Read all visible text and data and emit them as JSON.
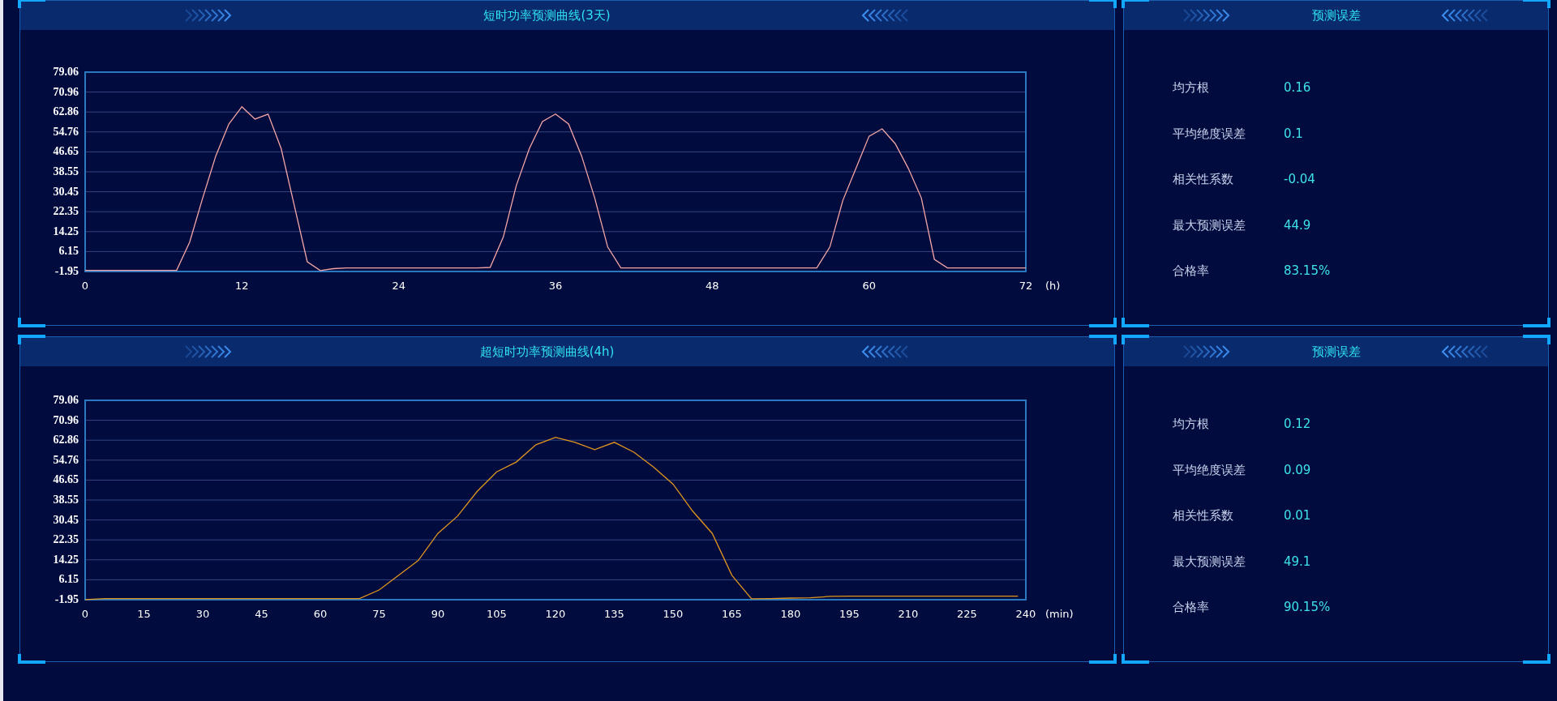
{
  "rows": [
    {
      "chart_panel": {
        "title": "短时功率预测曲线(3天)",
        "chart_data": {
          "type": "line",
          "xlabel": "(h)",
          "x": [
            0,
            1,
            2,
            3,
            4,
            5,
            6,
            7,
            8,
            9,
            10,
            11,
            12,
            13,
            14,
            15,
            16,
            17,
            18,
            19,
            20,
            21,
            22,
            23,
            24,
            25,
            26,
            27,
            28,
            29,
            30,
            31,
            32,
            33,
            34,
            35,
            36,
            37,
            38,
            39,
            40,
            41,
            42,
            43,
            44,
            45,
            46,
            47,
            48,
            49,
            50,
            51,
            52,
            53,
            54,
            55,
            56,
            57,
            58,
            59,
            60,
            61,
            62,
            63,
            64,
            65,
            66,
            67,
            68,
            69,
            70,
            71,
            72
          ],
          "series": [
            {
              "color": "#f4a6a6",
              "values": [
                -1.5,
                -1.5,
                -1.5,
                -1.5,
                -1.5,
                -1.5,
                -1.5,
                -1.5,
                10,
                28,
                45,
                58,
                65,
                60,
                62,
                48,
                25,
                2,
                -1.6,
                -0.8,
                -0.5,
                -0.5,
                -0.5,
                -0.5,
                -0.5,
                -0.5,
                -0.5,
                -0.5,
                -0.5,
                -0.5,
                -0.5,
                -0.3,
                12,
                33,
                48,
                59,
                62,
                58,
                45,
                28,
                8,
                -0.5,
                -0.5,
                -0.5,
                -0.5,
                -0.5,
                -0.5,
                -0.5,
                -0.5,
                -0.5,
                -0.5,
                -0.5,
                -0.5,
                -0.5,
                -0.5,
                -0.5,
                -0.5,
                8,
                27,
                40,
                53,
                56,
                50,
                40,
                28,
                3,
                -0.5,
                -0.5,
                -0.5,
                -0.5,
                -0.5,
                -0.5,
                -0.5
              ]
            }
          ],
          "xlim": [
            0,
            72
          ],
          "ylim": [
            -1.95,
            79.06
          ],
          "xticks": [
            0,
            12,
            24,
            36,
            48,
            60,
            72
          ],
          "yticks": [
            -1.95,
            6.15,
            14.25,
            22.35,
            30.45,
            38.55,
            46.65,
            54.76,
            62.86,
            70.96,
            79.06
          ],
          "grid": true
        }
      },
      "metrics_panel": {
        "title": "预测误差",
        "metrics": [
          {
            "label": "均方根",
            "value": "0.16"
          },
          {
            "label": "平均绝度误差",
            "value": "0.1"
          },
          {
            "label": "相关性系数",
            "value": "-0.04"
          },
          {
            "label": "最大预测误差",
            "value": "44.9"
          },
          {
            "label": "合格率",
            "value": "83.15%"
          }
        ]
      }
    },
    {
      "chart_panel": {
        "title": "超短时功率预测曲线(4h)",
        "chart_data": {
          "type": "line",
          "xlabel": "(min)",
          "x": [
            0,
            5,
            10,
            15,
            20,
            25,
            30,
            35,
            40,
            45,
            50,
            55,
            60,
            65,
            70,
            75,
            80,
            85,
            90,
            95,
            100,
            105,
            110,
            115,
            120,
            125,
            130,
            135,
            140,
            145,
            150,
            155,
            160,
            165,
            170,
            175,
            180,
            185,
            190,
            195,
            200,
            205,
            210,
            215,
            220,
            225,
            230,
            235,
            238
          ],
          "series": [
            {
              "color": "#e0961e",
              "values": [
                -1.9,
                -1.5,
                -1.5,
                -1.5,
                -1.5,
                -1.5,
                -1.5,
                -1.5,
                -1.5,
                -1.5,
                -1.5,
                -1.5,
                -1.5,
                -1.5,
                -1.5,
                2,
                8,
                14,
                25,
                32,
                42,
                50,
                54,
                61,
                64,
                62,
                59,
                62,
                58,
                52,
                45,
                34,
                25,
                8,
                -1.6,
                -1.5,
                -1.3,
                -1.2,
                -0.6,
                -0.5,
                -0.5,
                -0.5,
                -0.5,
                -0.5,
                -0.5,
                -0.5,
                -0.5,
                -0.5,
                -0.5
              ]
            }
          ],
          "xlim": [
            0,
            240
          ],
          "ylim": [
            -1.95,
            79.06
          ],
          "xticks": [
            0,
            15,
            30,
            45,
            60,
            75,
            90,
            105,
            120,
            135,
            150,
            165,
            180,
            195,
            210,
            225,
            240
          ],
          "yticks": [
            -1.95,
            6.15,
            14.25,
            22.35,
            30.45,
            38.55,
            46.65,
            54.76,
            62.86,
            70.96,
            79.06
          ],
          "grid": true
        }
      },
      "metrics_panel": {
        "title": "预测误差",
        "metrics": [
          {
            "label": "均方根",
            "value": "0.12"
          },
          {
            "label": "平均绝度误差",
            "value": "0.09"
          },
          {
            "label": "相关性系数",
            "value": "0.01"
          },
          {
            "label": "最大预测误差",
            "value": "49.1"
          },
          {
            "label": "合格率",
            "value": "90.15%"
          }
        ]
      }
    }
  ]
}
